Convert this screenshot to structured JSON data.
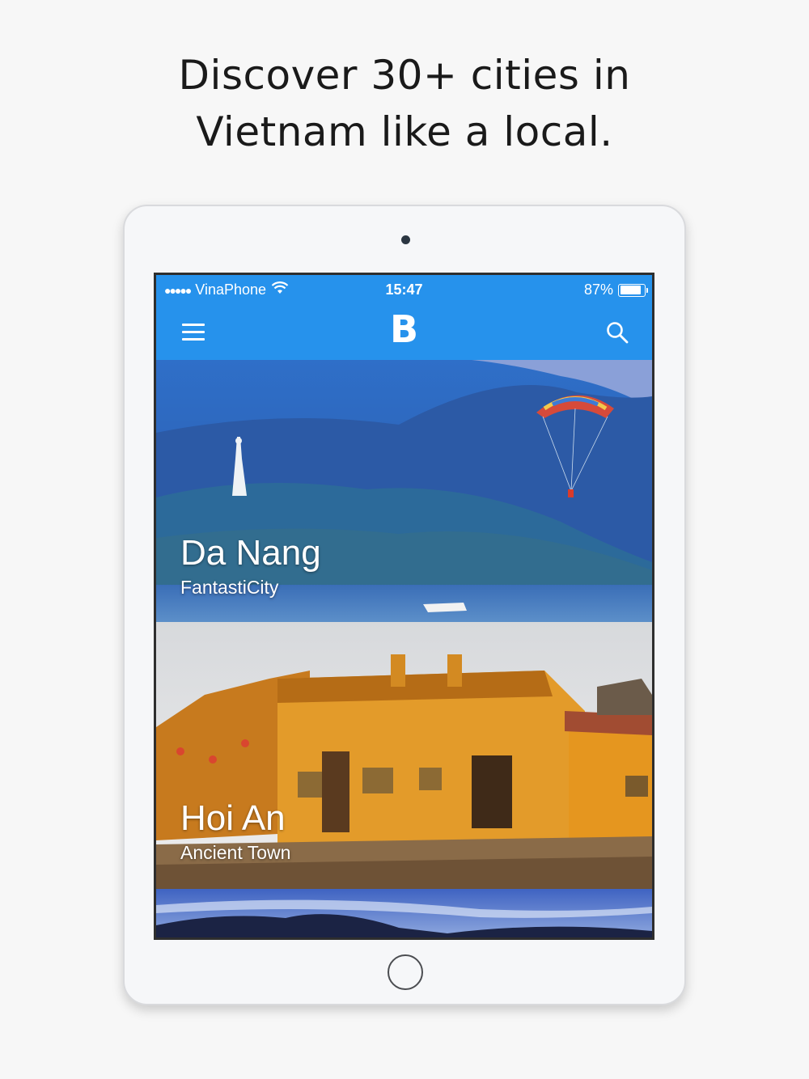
{
  "headline": {
    "line1": "Discover 30+ cities in",
    "line2": "Vietnam like a local."
  },
  "status_bar": {
    "signal": "●●●●●",
    "carrier": "VinaPhone",
    "time": "15:47",
    "battery": "87%",
    "battery_level": 0.87
  },
  "nav": {
    "logo": "B",
    "menu_icon": "hamburger-menu-icon",
    "search_icon": "search-icon"
  },
  "cities": [
    {
      "name": "Da Nang",
      "tagline": "FantastiCity"
    },
    {
      "name": "Hoi An",
      "tagline": "Ancient Town"
    }
  ],
  "colors": {
    "accent": "#2692ec",
    "background": "#f7f7f7"
  }
}
